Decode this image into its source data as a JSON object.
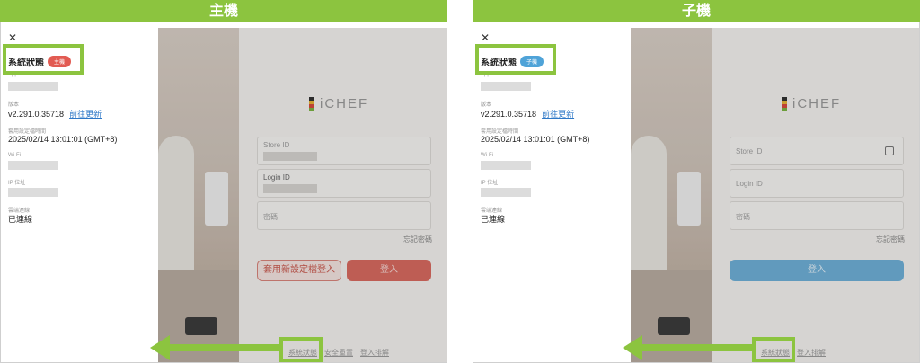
{
  "panels": [
    {
      "header": "主機",
      "sidebar": {
        "close_icon": "close-icon",
        "title": "系統狀態",
        "badge": "主機",
        "badge_color": "#e25b52",
        "appid_label": "App-ID",
        "version_label": "版本",
        "version_value": "v2.291.0.35718",
        "update_link": "前往更新",
        "config_time_label": "套用設定檔時間",
        "config_time_value": "2025/02/14 13:01:01 (GMT+8)",
        "wifi_label": "Wi-Fi",
        "ip_label": "IP 位址",
        "cloud_label": "雲端連線",
        "cloud_value": "已連線"
      },
      "login": {
        "logo_text": "iCHEF",
        "store_id_label": "Store ID",
        "login_id_label": "Login ID",
        "password_label": "密碼",
        "forgot": "忘記密碼",
        "apply_button": "套用新設定檔登入",
        "login_button": "登入",
        "links": [
          "系統狀態",
          "安全重置",
          "登入排解"
        ]
      }
    },
    {
      "header": "子機",
      "sidebar": {
        "close_icon": "close-icon",
        "title": "系統狀態",
        "badge": "子機",
        "badge_color": "#4fa3d8",
        "appid_label": "App-ID",
        "version_label": "版本",
        "version_value": "v2.291.0.35718",
        "update_link": "前往更新",
        "config_time_label": "套用設定檔時間",
        "config_time_value": "2025/02/14 13:01:01 (GMT+8)",
        "wifi_label": "Wi-Fi",
        "ip_label": "IP 位址",
        "cloud_label": "雲端連線",
        "cloud_value": "已連線"
      },
      "login": {
        "logo_text": "iCHEF",
        "store_id_label": "Store ID",
        "login_id_label": "Login ID",
        "password_label": "密碼",
        "forgot": "忘記密碼",
        "login_button": "登入",
        "links": [
          "系統狀態",
          "登入排解"
        ]
      }
    }
  ],
  "colors": {
    "highlight": "#8cc43f"
  }
}
